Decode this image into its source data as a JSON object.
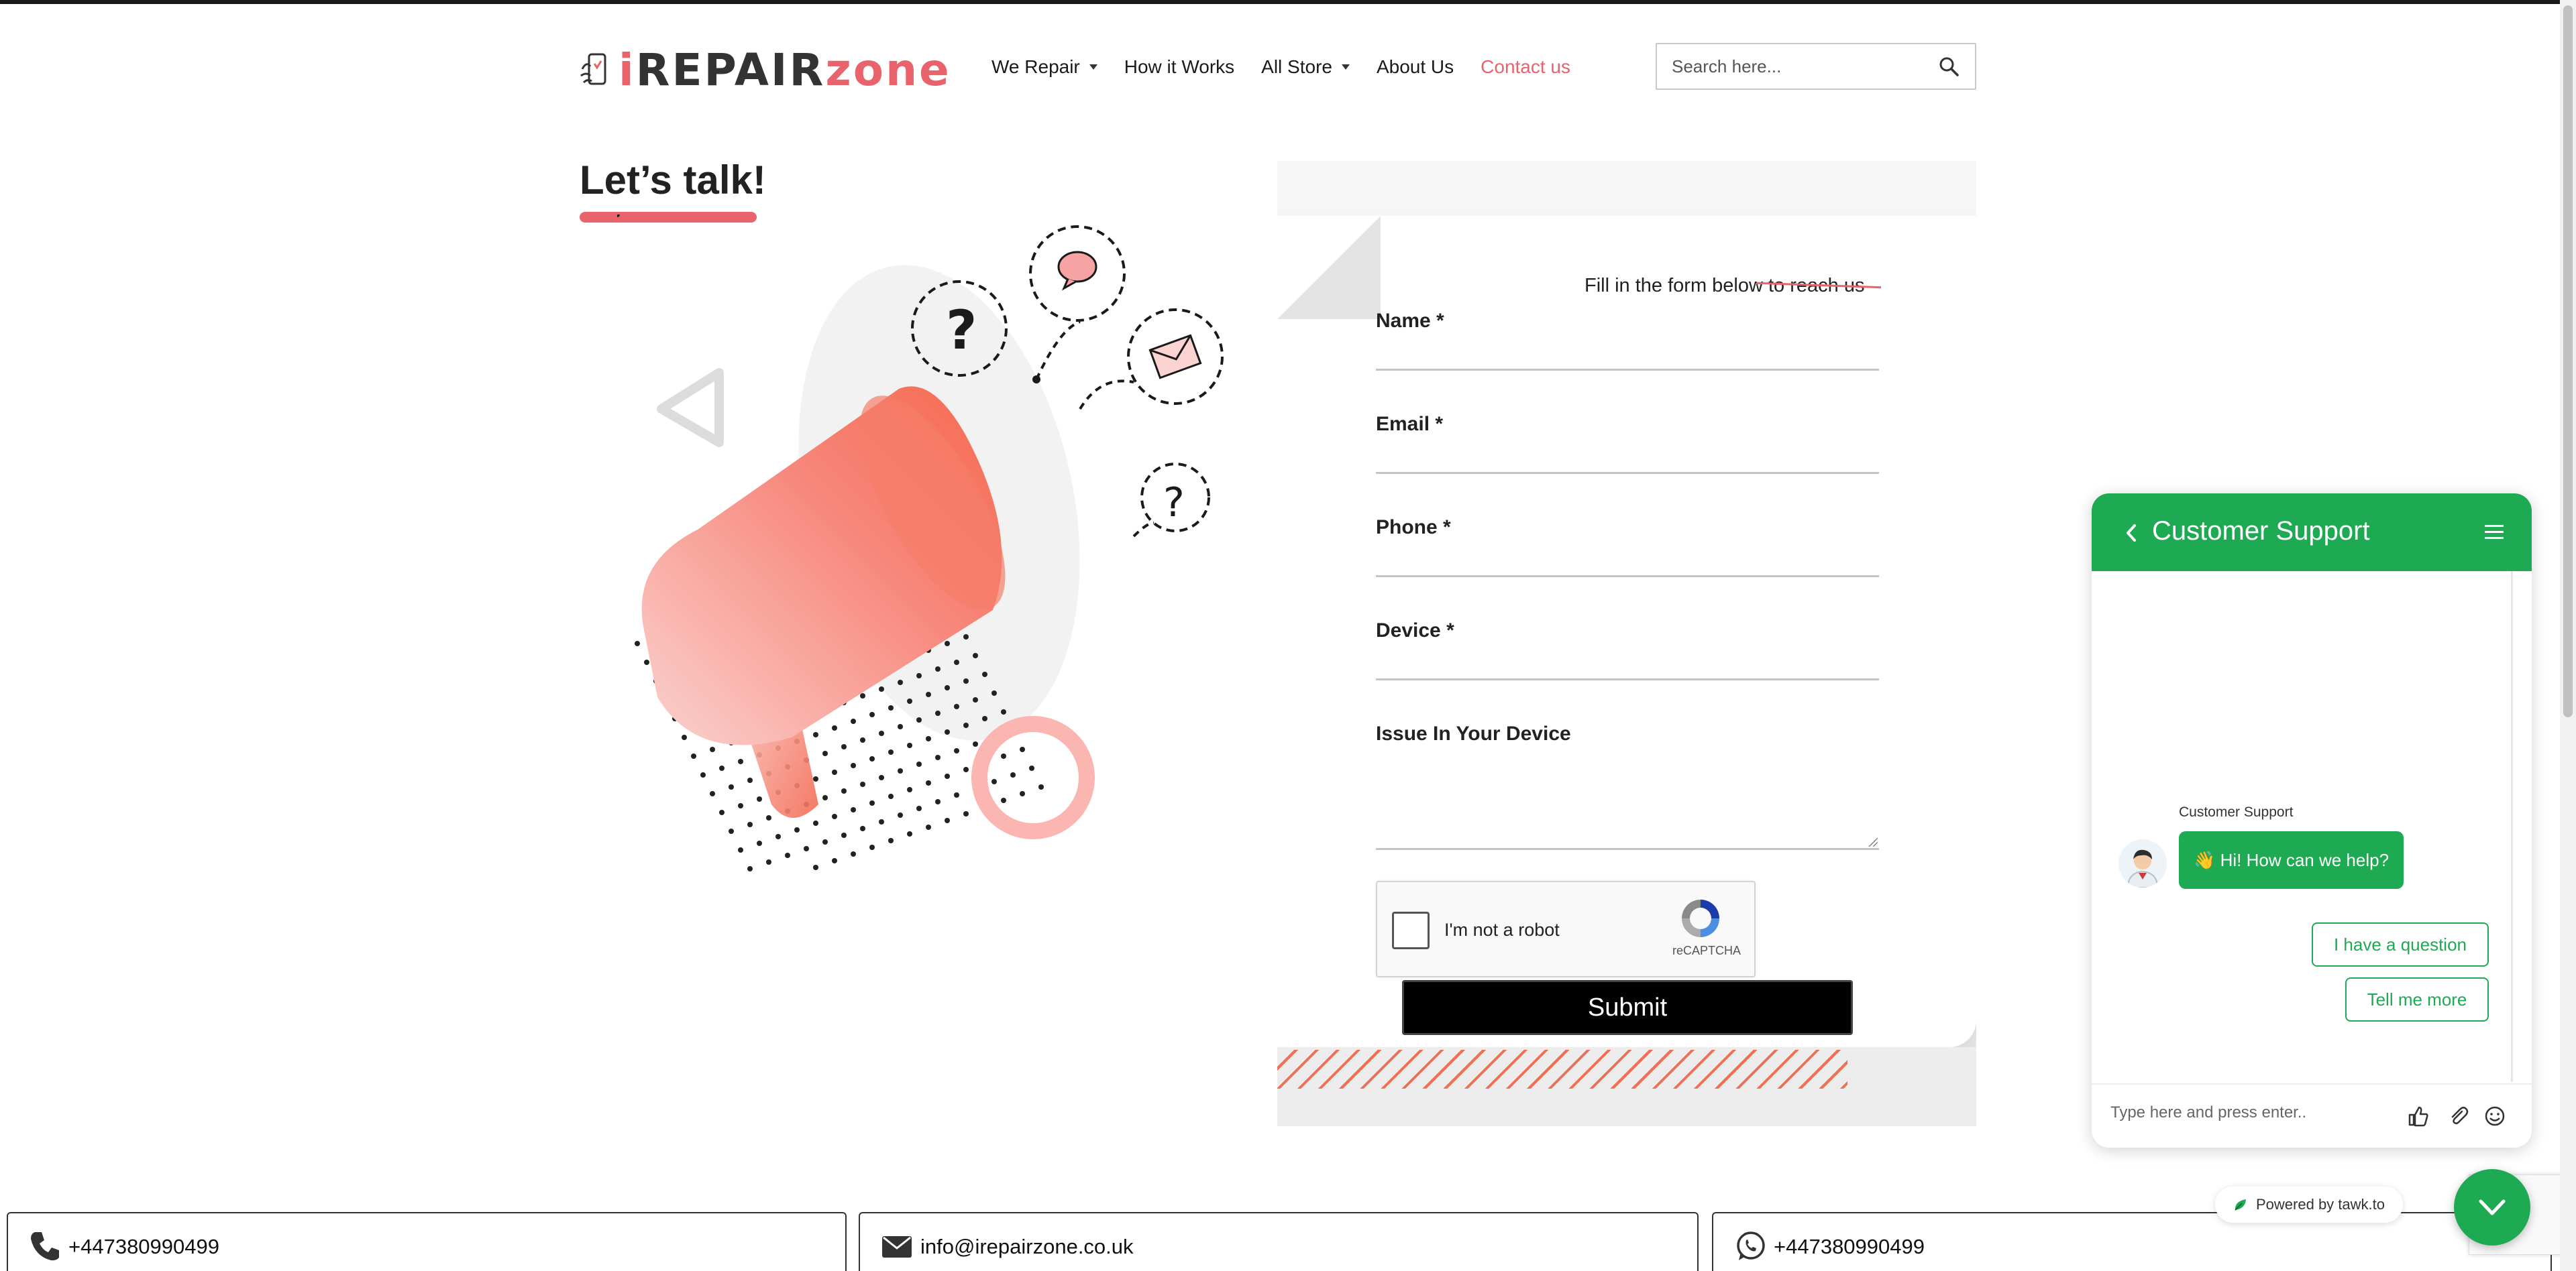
{
  "logo": {
    "part1": "i",
    "part2": "REPAIR",
    "part3": "zone",
    "alt": "iREPAIRzone"
  },
  "nav": {
    "items": [
      {
        "label": "We Repair",
        "dropdown": true
      },
      {
        "label": "How it Works",
        "dropdown": false
      },
      {
        "label": "All Store",
        "dropdown": true
      },
      {
        "label": "About Us",
        "dropdown": false
      },
      {
        "label": "Contact us",
        "dropdown": false,
        "active": true
      }
    ]
  },
  "search": {
    "placeholder": "Search here..."
  },
  "page": {
    "title": "Let’s talk!"
  },
  "form": {
    "intro": "Fill in the form below to reach us",
    "fields": [
      {
        "label": "Name *",
        "value": ""
      },
      {
        "label": "Email *",
        "value": ""
      },
      {
        "label": "Phone *",
        "value": ""
      },
      {
        "label": "Device *",
        "value": ""
      },
      {
        "label": "Issue In Your Device",
        "value": ""
      }
    ],
    "recaptcha_text": "I'm not a robot",
    "recaptcha_brand": "reCAPTCHA",
    "submit_label": "Submit"
  },
  "contacts": [
    {
      "icon": "phone-icon",
      "text": "+447380990499"
    },
    {
      "icon": "mail-icon",
      "text": "info@irepairzone.co.uk"
    },
    {
      "icon": "whatsapp-icon",
      "text": "+447380990499"
    }
  ],
  "chat": {
    "title": "Customer Support",
    "sender": "Customer Support",
    "greeting": "👋 Hi! How can we help?",
    "options": [
      "I have a question",
      "Tell me more"
    ],
    "input_placeholder": "Type here and press enter..",
    "powered_by": "Powered by tawk.to"
  },
  "colors": {
    "accent": "#e8636b",
    "chat_green": "#1eaa52",
    "stripe": "#f15a3a",
    "dark": "#000000"
  }
}
